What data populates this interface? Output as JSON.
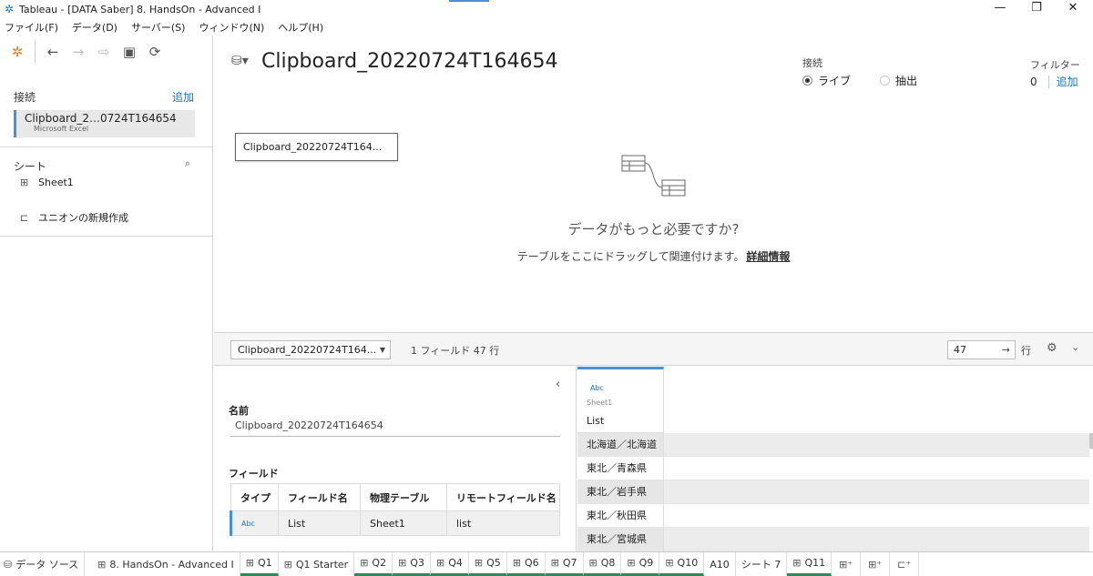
{
  "window": {
    "title": "Tableau - [DATA Saber] 8. HandsOn - Advanced I",
    "minimize": "—",
    "restore": "❐",
    "close": "✕"
  },
  "menu": [
    "ファイル(F)",
    "データ(D)",
    "サーバー(S)",
    "ウィンドウ(N)",
    "ヘルプ(H)"
  ],
  "sidebar": {
    "connections_label": "接続",
    "add_label": "追加",
    "connection": {
      "name": "Clipboard_2…0724T164654",
      "type": "Microsoft Excel"
    },
    "sheets_label": "シート",
    "sheets": [
      {
        "label": "Sheet1"
      }
    ],
    "new_union_label": "ユニオンの新規作成"
  },
  "main": {
    "datasource_title": "Clipboard_20220724T164654",
    "connection_mode_label": "接続",
    "live_label": "ライブ",
    "extract_label": "抽出",
    "filters_label": "フィルター",
    "filters_count": "0",
    "filters_add": "追加",
    "table_chip": "Clipboard_20220724T164...",
    "need_more_title": "データがもっと必要ですか?",
    "need_more_sub": "テーブルをここにドラッグして関連付けます。",
    "details_link": "詳細情報"
  },
  "grid_bar": {
    "table_select": "Clipboard_20220724T164...",
    "field_count": "1 フィールド 47 行",
    "rows_value": "47",
    "go_arrow": "→",
    "rows_label": "行"
  },
  "meta": {
    "name_label": "名前",
    "name_value": "Clipboard_20220724T164654",
    "fields_label": "フィールド",
    "columns": [
      "タイプ",
      "フィールド名",
      "物理テーブル",
      "リモートフィールド名"
    ],
    "rows": [
      {
        "type": "Abc",
        "field": "List",
        "table": "Sheet1",
        "remote": "list"
      }
    ]
  },
  "grid": {
    "column": {
      "type": "Abc",
      "source": "Sheet1",
      "name": "List"
    },
    "rows": [
      "北海道／北海道",
      "東北／青森県",
      "東北／岩手県",
      "東北／秋田県",
      "東北／宮城県"
    ]
  },
  "tabs": {
    "datasource": "データ ソース",
    "sheets": [
      "8. HandsOn - Advanced I",
      "Q1",
      "Q1 Starter",
      "Q2",
      "Q3",
      "Q4",
      "Q5",
      "Q6",
      "Q7",
      "Q8",
      "Q9",
      "Q10",
      "A10",
      "シート 7",
      "Q11"
    ]
  },
  "colors": {
    "accent": "#4a90d9",
    "link": "#1f77b4",
    "tab_underline": "#2e8b57"
  }
}
